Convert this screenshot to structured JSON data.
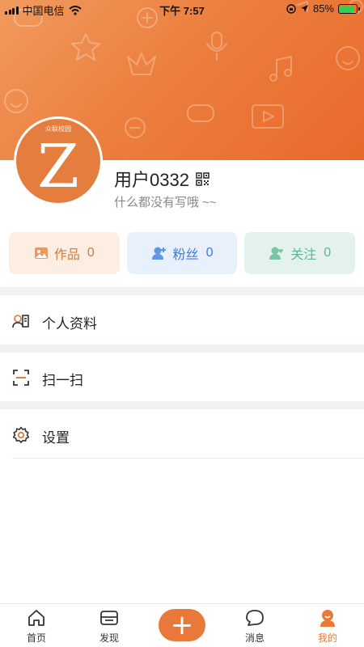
{
  "status_bar": {
    "carrier": "中国电信",
    "time": "下午 7:57",
    "battery_percent": "85%",
    "battery_level": 0.85,
    "battery_color": "#2fd152"
  },
  "header": {
    "avatar_org_label": "众联校园",
    "avatar_letter": "Z",
    "username": "用户0332",
    "bio": "什么都没有写哦 ~~",
    "qr_icon": "qr-code-icon",
    "gradient_colors": [
      "#f19a5e",
      "#e8692a"
    ]
  },
  "stats": [
    {
      "label": "作品",
      "count": "0",
      "icon": "image-icon",
      "color": "#d47a3c"
    },
    {
      "label": "粉丝",
      "count": "0",
      "icon": "user-plus-icon",
      "color": "#3e7bd6"
    },
    {
      "label": "关注",
      "count": "0",
      "icon": "user-heart-icon",
      "color": "#5db691"
    }
  ],
  "menu": [
    {
      "label": "个人资料",
      "icon": "profile-card-icon"
    },
    {
      "label": "扫一扫",
      "icon": "scan-icon"
    },
    {
      "label": "设置",
      "icon": "gear-icon"
    }
  ],
  "tabbar": {
    "items": [
      {
        "label": "首页",
        "icon": "home-icon"
      },
      {
        "label": "发现",
        "icon": "discover-icon"
      },
      {
        "label": "",
        "icon": "plus-icon"
      },
      {
        "label": "消息",
        "icon": "message-icon"
      },
      {
        "label": "我的",
        "icon": "me-icon"
      }
    ],
    "active_index": 4,
    "accent_color": "#e77a35"
  }
}
